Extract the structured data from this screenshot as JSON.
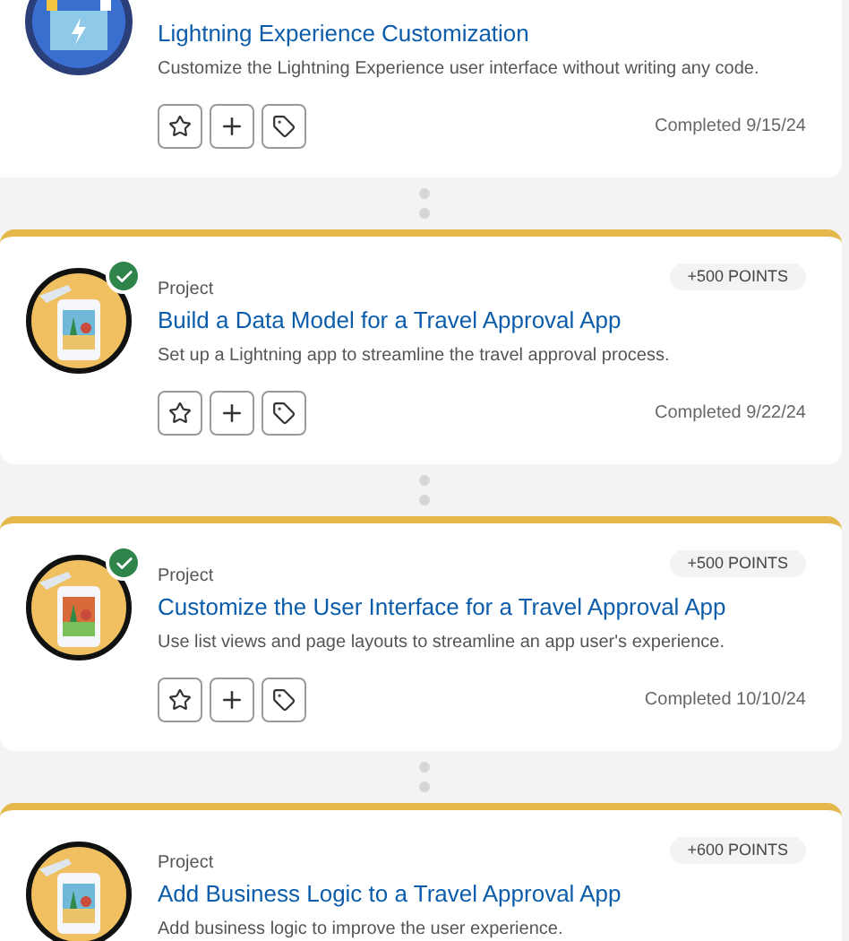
{
  "cards": [
    {
      "kind": "module",
      "title": "Lightning Experience Customization",
      "description": "Customize the Lightning Experience user interface without writing any code.",
      "status": "Completed 9/15/24"
    },
    {
      "kind": "project",
      "completed": true,
      "type": "Project",
      "points": "+500 POINTS",
      "title": "Build a Data Model for a Travel Approval App",
      "description": "Set up a Lightning app to streamline the travel approval process.",
      "status": "Completed 9/22/24"
    },
    {
      "kind": "project",
      "completed": true,
      "type": "Project",
      "points": "+500 POINTS",
      "title": "Customize the User Interface for a Travel Approval App",
      "description": "Use list views and page layouts to streamline an app user's experience.",
      "status": "Completed 10/10/24"
    },
    {
      "kind": "project",
      "completed": false,
      "type": "Project",
      "points": "+600 POINTS",
      "title": "Add Business Logic to a Travel Approval App",
      "description": "Add business logic to improve the user experience."
    }
  ]
}
